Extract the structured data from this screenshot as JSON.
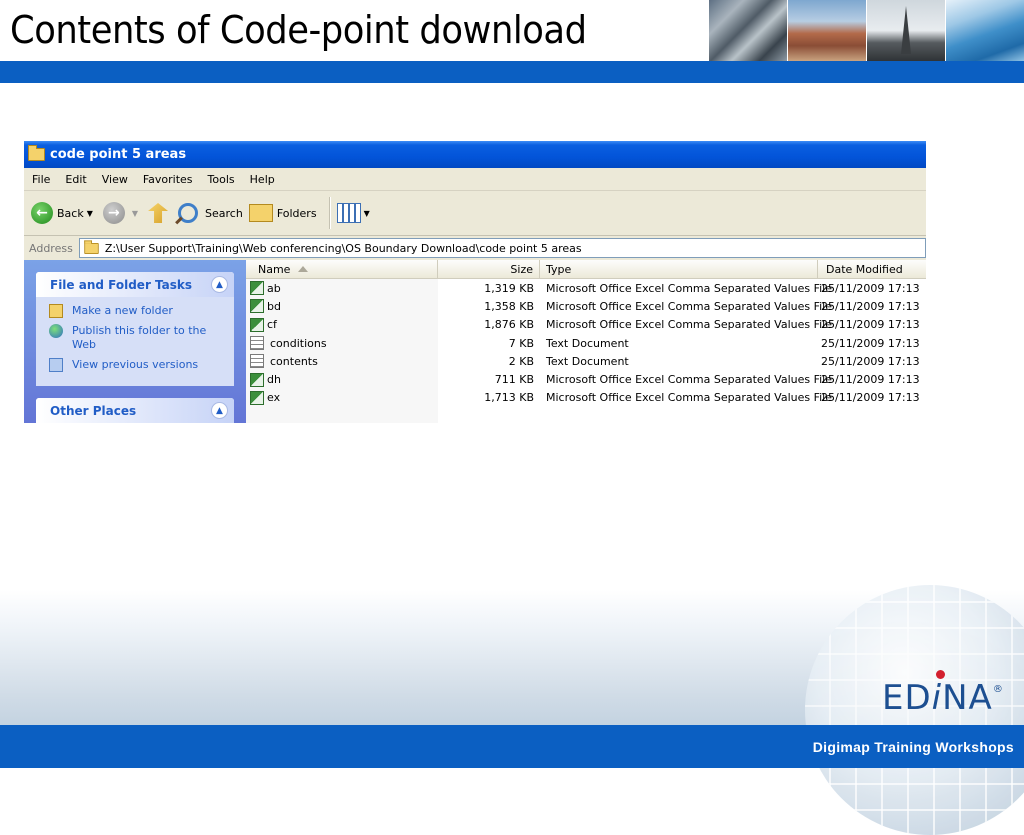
{
  "slide": {
    "title": "Contents of Code-point download",
    "footer": "Digimap Training Workshops",
    "logo": {
      "prefix": "ED",
      "i": "i",
      "suffix": "NA",
      "reg": "®"
    }
  },
  "window": {
    "title": "code point 5 areas",
    "menu": [
      "File",
      "Edit",
      "View",
      "Favorites",
      "Tools",
      "Help"
    ],
    "toolbar": {
      "back": "Back",
      "search": "Search",
      "folders": "Folders"
    },
    "address": {
      "label": "Address",
      "path": "Z:\\User Support\\Training\\Web conferencing\\OS Boundary Download\\code point 5 areas"
    }
  },
  "tasks": {
    "file_folder": {
      "title": "File and Folder Tasks",
      "items": [
        "Make a new folder",
        "Publish this folder to the Web",
        "View previous versions"
      ]
    },
    "other_places": {
      "title": "Other Places"
    }
  },
  "columns": {
    "name": "Name",
    "size": "Size",
    "type": "Type",
    "date": "Date Modified"
  },
  "files": [
    {
      "name": "ab",
      "size": "1,319 KB",
      "type": "Microsoft Office Excel Comma Separated Values File",
      "date": "25/11/2009 17:13",
      "icon": "excel"
    },
    {
      "name": "bd",
      "size": "1,358 KB",
      "type": "Microsoft Office Excel Comma Separated Values File",
      "date": "25/11/2009 17:13",
      "icon": "excel"
    },
    {
      "name": "cf",
      "size": "1,876 KB",
      "type": "Microsoft Office Excel Comma Separated Values File",
      "date": "25/11/2009 17:13",
      "icon": "excel"
    },
    {
      "name": "conditions",
      "size": "7 KB",
      "type": "Text Document",
      "date": "25/11/2009 17:13",
      "icon": "text"
    },
    {
      "name": "contents",
      "size": "2 KB",
      "type": "Text Document",
      "date": "25/11/2009 17:13",
      "icon": "text"
    },
    {
      "name": "dh",
      "size": "711 KB",
      "type": "Microsoft Office Excel Comma Separated Values File",
      "date": "25/11/2009 17:13",
      "icon": "excel"
    },
    {
      "name": "ex",
      "size": "1,713 KB",
      "type": "Microsoft Office Excel Comma Separated Values File",
      "date": "25/11/2009 17:13",
      "icon": "excel"
    }
  ]
}
